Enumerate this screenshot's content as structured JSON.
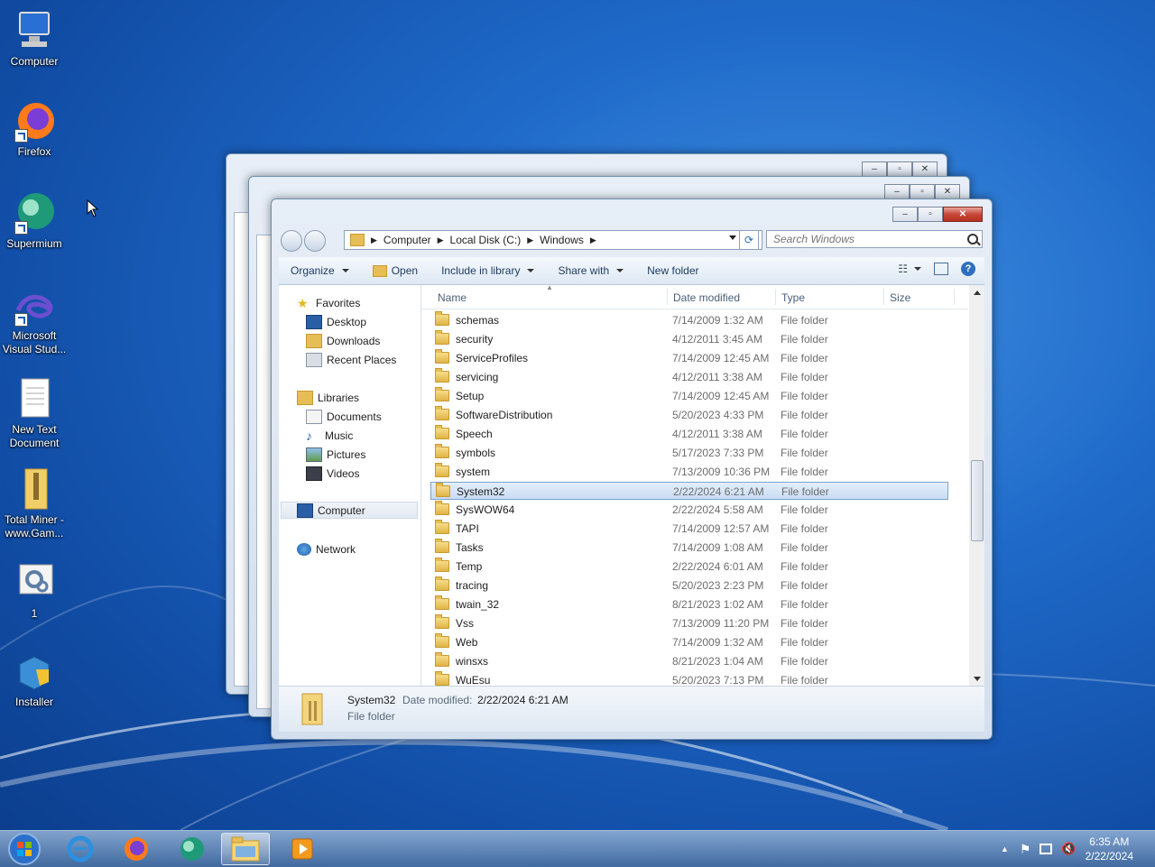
{
  "desktop": {
    "icons": [
      {
        "label": "Computer"
      },
      {
        "label": "Firefox"
      },
      {
        "label": "Supermium"
      },
      {
        "label": "Microsoft Visual Stud..."
      },
      {
        "label": "New Text Document"
      },
      {
        "label": "Total Miner - www.Gam..."
      },
      {
        "label": "1"
      },
      {
        "label": "Installer"
      }
    ]
  },
  "explorer": {
    "breadcrumbs": [
      "Computer",
      "Local Disk (C:)",
      "Windows"
    ],
    "search_placeholder": "Search Windows",
    "toolbar": {
      "organize": "Organize",
      "open": "Open",
      "include_in_library": "Include in library",
      "share_with": "Share with",
      "new_folder": "New folder"
    },
    "nav": {
      "favorites": "Favorites",
      "desktop": "Desktop",
      "downloads": "Downloads",
      "recent_places": "Recent Places",
      "libraries": "Libraries",
      "documents": "Documents",
      "music": "Music",
      "pictures": "Pictures",
      "videos": "Videos",
      "computer": "Computer",
      "network": "Network"
    },
    "columns": {
      "name": "Name",
      "date": "Date modified",
      "type": "Type",
      "size": "Size"
    },
    "files": [
      {
        "name": "schemas",
        "date": "7/14/2009 1:32 AM",
        "type": "File folder"
      },
      {
        "name": "security",
        "date": "4/12/2011 3:45 AM",
        "type": "File folder"
      },
      {
        "name": "ServiceProfiles",
        "date": "7/14/2009 12:45 AM",
        "type": "File folder"
      },
      {
        "name": "servicing",
        "date": "4/12/2011 3:38 AM",
        "type": "File folder"
      },
      {
        "name": "Setup",
        "date": "7/14/2009 12:45 AM",
        "type": "File folder"
      },
      {
        "name": "SoftwareDistribution",
        "date": "5/20/2023 4:33 PM",
        "type": "File folder"
      },
      {
        "name": "Speech",
        "date": "4/12/2011 3:38 AM",
        "type": "File folder"
      },
      {
        "name": "symbols",
        "date": "5/17/2023 7:33 PM",
        "type": "File folder"
      },
      {
        "name": "system",
        "date": "7/13/2009 10:36 PM",
        "type": "File folder"
      },
      {
        "name": "System32",
        "date": "2/22/2024 6:21 AM",
        "type": "File folder"
      },
      {
        "name": "SysWOW64",
        "date": "2/22/2024 5:58 AM",
        "type": "File folder"
      },
      {
        "name": "TAPI",
        "date": "7/14/2009 12:57 AM",
        "type": "File folder"
      },
      {
        "name": "Tasks",
        "date": "7/14/2009 1:08 AM",
        "type": "File folder"
      },
      {
        "name": "Temp",
        "date": "2/22/2024 6:01 AM",
        "type": "File folder"
      },
      {
        "name": "tracing",
        "date": "5/20/2023 2:23 PM",
        "type": "File folder"
      },
      {
        "name": "twain_32",
        "date": "8/21/2023 1:02 AM",
        "type": "File folder"
      },
      {
        "name": "Vss",
        "date": "7/13/2009 11:20 PM",
        "type": "File folder"
      },
      {
        "name": "Web",
        "date": "7/14/2009 1:32 AM",
        "type": "File folder"
      },
      {
        "name": "winsxs",
        "date": "8/21/2023 1:04 AM",
        "type": "File folder"
      },
      {
        "name": "WuEsu",
        "date": "5/20/2023 7:13 PM",
        "type": "File folder"
      }
    ],
    "details": {
      "name": "System32",
      "date_label": "Date modified:",
      "date_value": "2/22/2024 6:21 AM",
      "type": "File folder"
    }
  },
  "taskbar": {
    "time": "6:35 AM",
    "date": "2/22/2024"
  },
  "colors": {
    "accent": "#1f6ac9",
    "selection": "#c9dcf3",
    "close_button": "#c7473a"
  }
}
